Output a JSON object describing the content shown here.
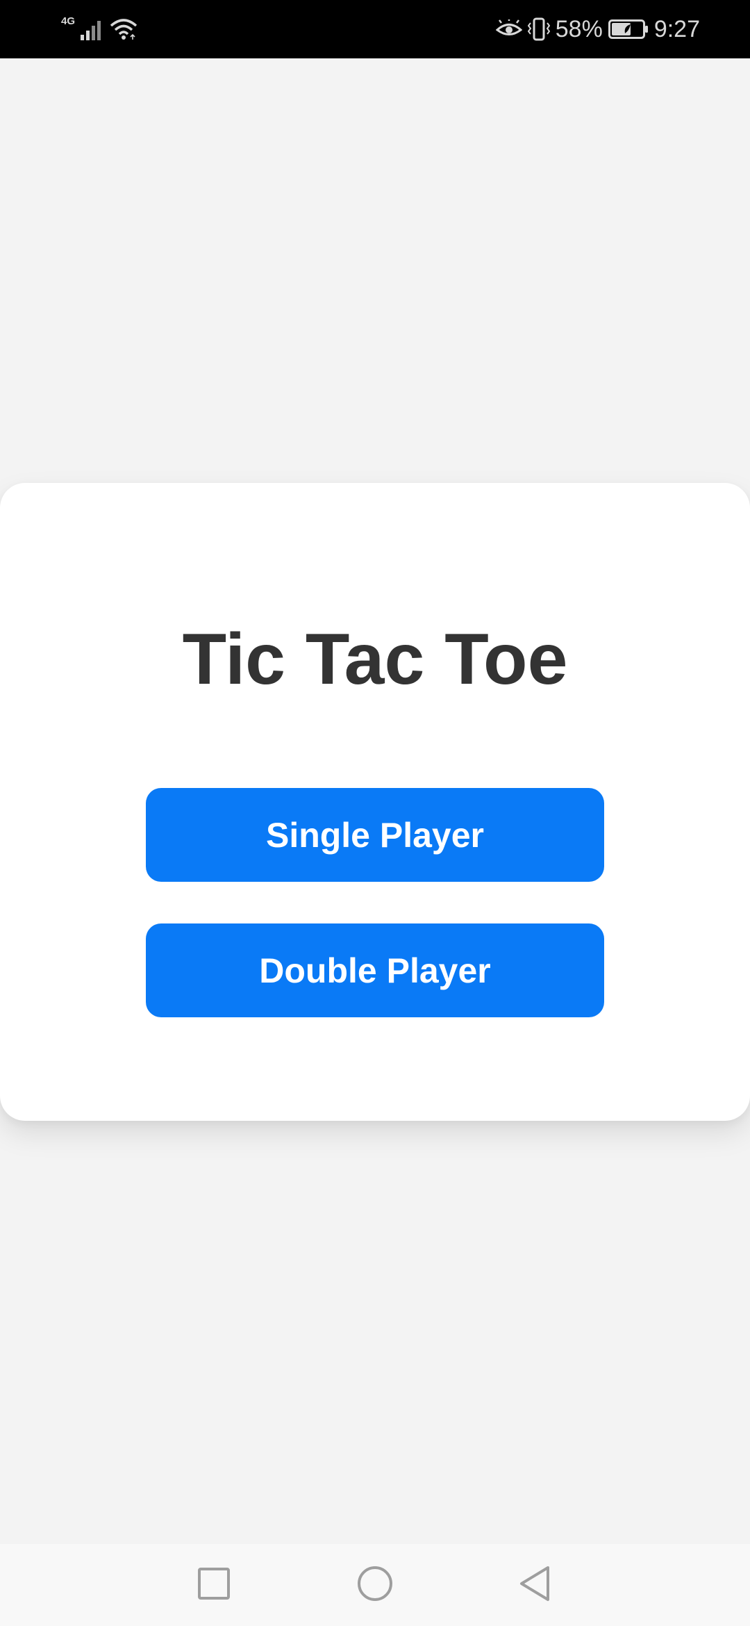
{
  "status_bar": {
    "network_label": "4G",
    "battery_percent": "58%",
    "time": "9:27",
    "icons": [
      "signal-icon",
      "wifi-icon",
      "eye-comfort-icon",
      "vibrate-icon",
      "battery-icon"
    ]
  },
  "card": {
    "title": "Tic Tac Toe",
    "single_player_label": "Single Player",
    "double_player_label": "Double Player"
  },
  "nav_bar": {
    "icons": [
      "recent-apps-icon",
      "home-icon",
      "back-icon"
    ]
  },
  "colors": {
    "accent": "#0a7af6",
    "title_text": "#333333",
    "background": "#f3f3f3",
    "card": "#ffffff",
    "status_bar": "#000000"
  }
}
